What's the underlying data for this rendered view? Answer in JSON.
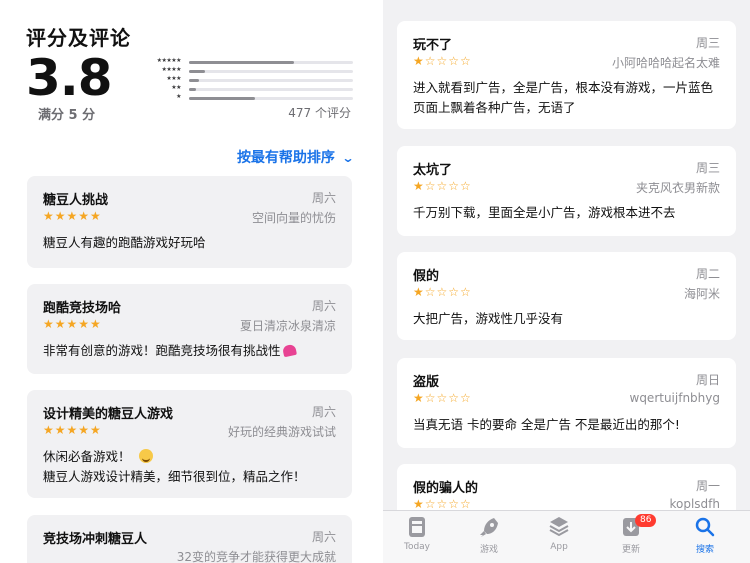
{
  "ratings": {
    "title": "评分及评论",
    "score": "3.8",
    "out_of": "满分 5 分",
    "count": "477 个评分",
    "distribution": [
      {
        "stars": "★★★★★",
        "fraction": 0.64
      },
      {
        "stars": "★★★★",
        "fraction": 0.1
      },
      {
        "stars": "★★★",
        "fraction": 0.06
      },
      {
        "stars": "★★",
        "fraction": 0.04
      },
      {
        "stars": "★",
        "fraction": 0.4
      }
    ]
  },
  "sort": {
    "label": "按最有帮助排序",
    "icon": "chevron-down-icon"
  },
  "left_reviews": [
    {
      "title": "糖豆人挑战",
      "date": "周六",
      "rating": 5,
      "stars": "★★★★★",
      "author": "空间向量的忧伤",
      "body": "糖豆人有趣的跑酷游戏好玩哈"
    },
    {
      "title": "跑酷竞技场哈",
      "date": "周六",
      "rating": 5,
      "stars": "★★★★★",
      "author": "夏日清凉冰泉清凉",
      "body": "非常有创意的游戏！跑酷竞技场很有挑战性"
    },
    {
      "title": "设计精美的糖豆人游戏",
      "date": "周六",
      "rating": 5,
      "stars": "★★★★★",
      "author": "好玩的经典游戏试试",
      "body_line1": "休闲必备游戏！",
      "body_line2": "糖豆人游戏设计精美，细节很到位，精品之作！"
    },
    {
      "title": "竞技场冲刺糖豆人",
      "date": "周六",
      "author": "32变的竞争才能获得更大成就"
    }
  ],
  "right_reviews": [
    {
      "title": "玩不了",
      "date": "周三",
      "rating": 1,
      "stars": "★☆☆☆☆",
      "author": "小阿哈哈哈起名太难",
      "body": "进入就看到广告，全是广告，根本没有游戏，一片蓝色页面上飘着各种广告，无语了"
    },
    {
      "title": "太坑了",
      "date": "周三",
      "rating": 1,
      "stars": "★☆☆☆☆",
      "author": "夹克风衣男新款",
      "body": "千万别下载，里面全是小广告，游戏根本进不去"
    },
    {
      "title": "假的",
      "date": "周二",
      "rating": 1,
      "stars": "★☆☆☆☆",
      "author": "海阿米",
      "body": "大把广告，游戏性几乎没有"
    },
    {
      "title": "盗版",
      "date": "周日",
      "rating": 1,
      "stars": "★☆☆☆☆",
      "author": "wqertuijfnbhyg",
      "body": "当真无语 卡的要命 全是广告 不是最近出的那个!"
    },
    {
      "title": "假的骗人的",
      "date": "周一",
      "rating": 1,
      "stars": "★☆☆☆☆",
      "author": "koplsdfh"
    }
  ],
  "tabbar": [
    {
      "label": "Today",
      "icon": "today-icon"
    },
    {
      "label": "游戏",
      "icon": "rocket-icon"
    },
    {
      "label": "App",
      "icon": "app-stack-icon"
    },
    {
      "label": "更新",
      "icon": "updates-icon",
      "badge": "86"
    },
    {
      "label": "搜索",
      "icon": "search-icon",
      "active": true
    }
  ],
  "colors": {
    "accent": "#1a73e8",
    "star": "#f5a623",
    "badge": "#ff3b30"
  }
}
